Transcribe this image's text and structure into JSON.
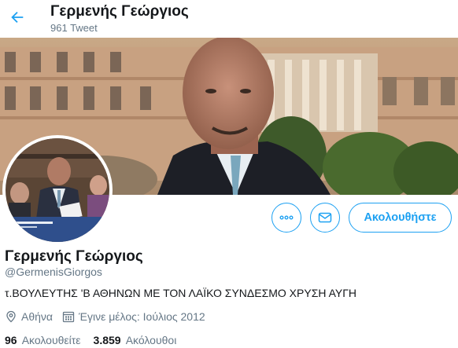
{
  "header": {
    "title": "Γερμενής Γεώργιος",
    "tweet_count": "961 Tweet"
  },
  "actions": {
    "follow_label": "Ακολουθήστε",
    "more_icon": "more-icon",
    "message_icon": "mail-icon"
  },
  "profile": {
    "name": "Γερμενής Γεώργιος",
    "handle": "@GermenisGiorgos",
    "bio": "τ.ΒΟΥΛΕΥΤΗΣ 'Β ΑΘΗΝΩΝ ΜΕ ΤΟΝ ΛΑΪΚΟ ΣΥΝΔΕΣΜΟ ΧΡΥΣΗ ΑΥΓΗ",
    "location": "Αθήνα",
    "joined": "Έγινε μέλος: Ιούλιος 2012",
    "following_count": "96",
    "following_label": "Ακολουθείτε",
    "followers_count": "3.859",
    "followers_label": "Ακόλουθοι"
  },
  "colors": {
    "accent": "#1da1f2",
    "text": "#14171a",
    "secondary_text": "#657786"
  }
}
